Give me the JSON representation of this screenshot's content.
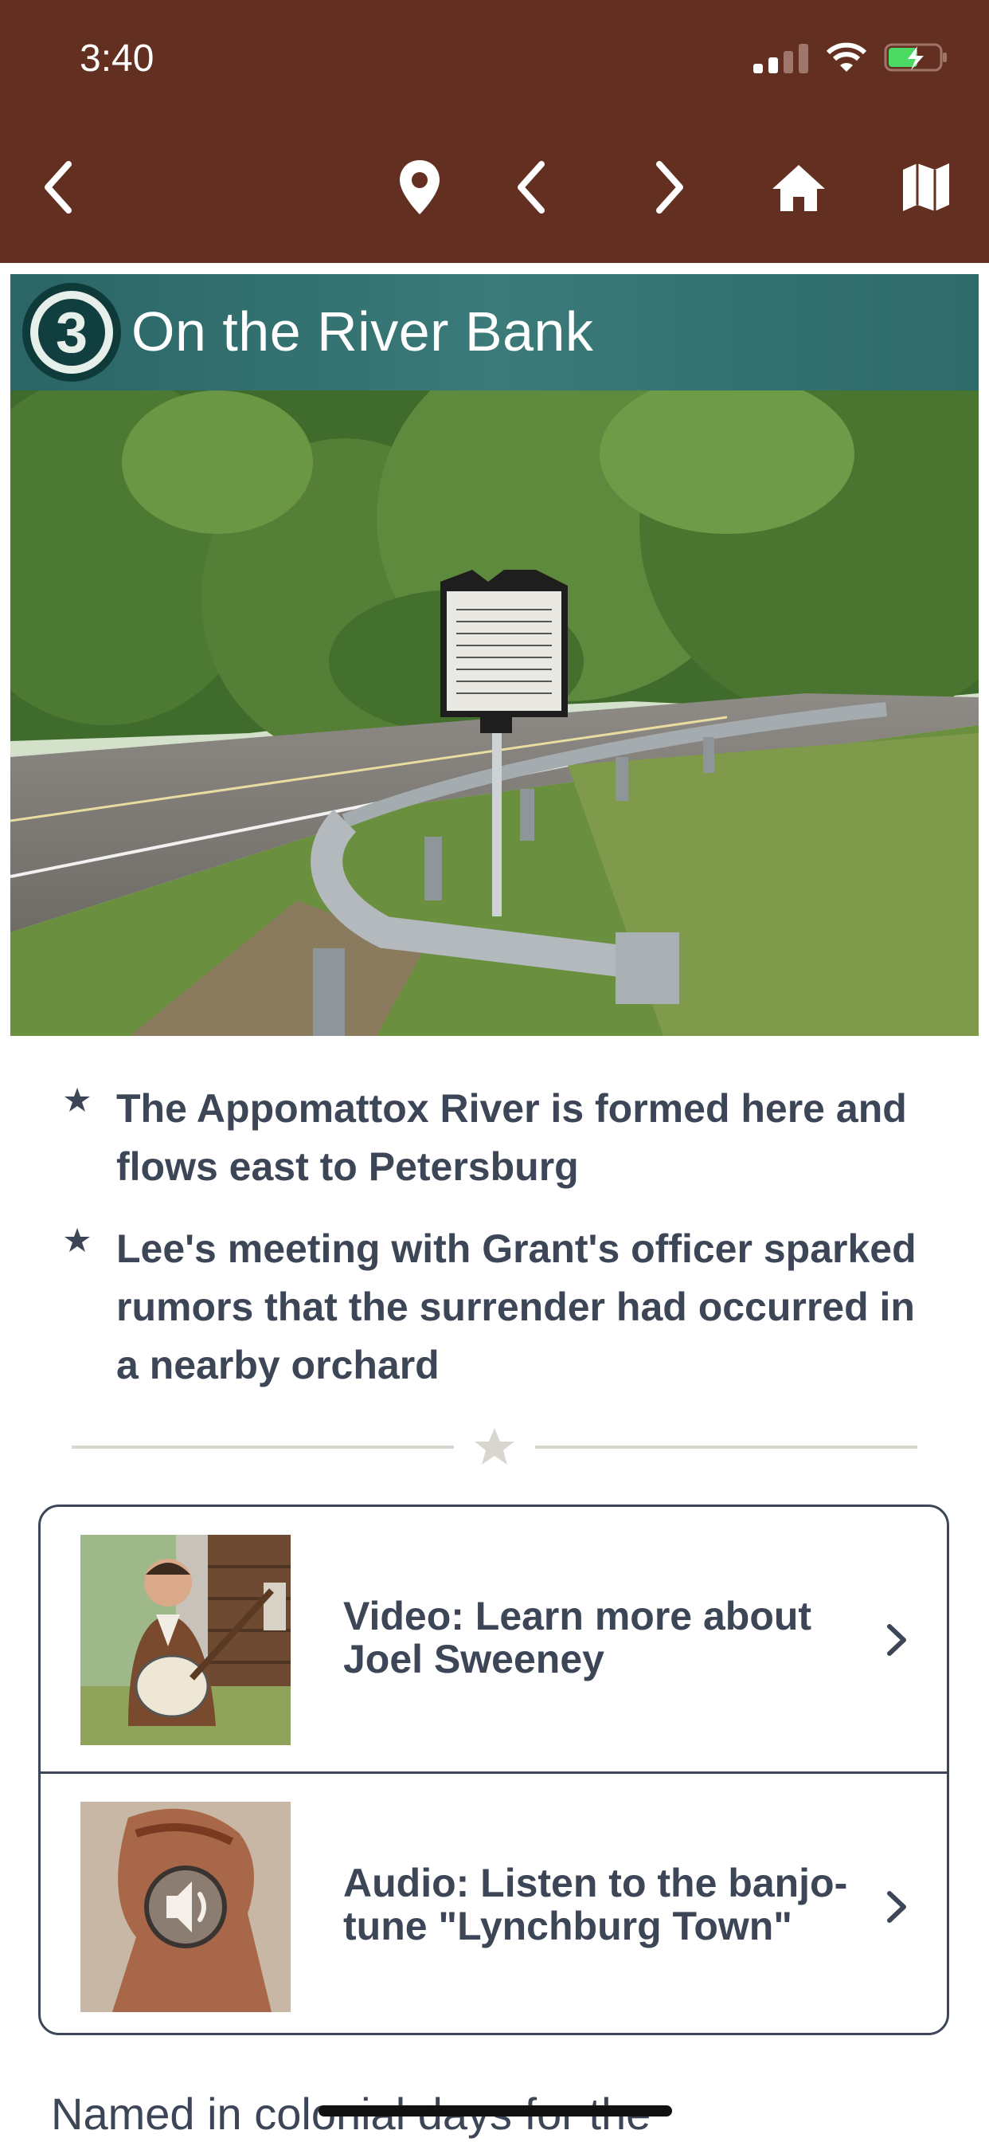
{
  "status_bar": {
    "time": "3:40"
  },
  "toolbar": {
    "icons": [
      "back-chevron-icon",
      "map-pin-icon",
      "prev-chevron-icon",
      "next-chevron-icon",
      "home-icon",
      "map-icon"
    ]
  },
  "stop": {
    "number": "3",
    "title": "On the River Bank"
  },
  "bullets": [
    {
      "text": "The Appomattox River is formed here and flows east to Petersburg"
    },
    {
      "text": "Lee's meeting with Grant's officer sparked rumors that the surrender had occurred in a nearby orchard"
    }
  ],
  "media": [
    {
      "label": "Video: Learn more about Joel Sweeney",
      "icon": "video-thumbnail"
    },
    {
      "label": "Audio: Listen to the banjo-tune \"Lynchburg Town\"",
      "icon": "speaker-icon"
    }
  ],
  "body_preview": "Named in colonial days for the",
  "colors": {
    "header_brown": "#632f20",
    "title_teal": "#2e6b6a",
    "text_slate": "#3d4657",
    "divider_gray": "#d9d6d0"
  }
}
